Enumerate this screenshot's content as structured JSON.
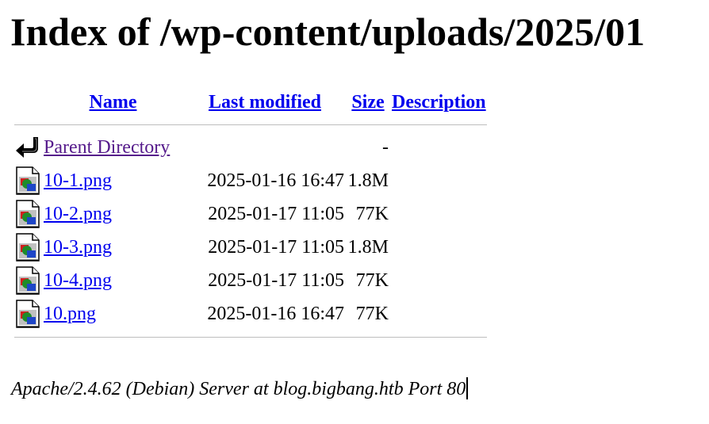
{
  "page": {
    "heading": "Index of /wp-content/uploads/2025/01"
  },
  "table": {
    "headers": {
      "name": "Name",
      "last_modified": "Last modified",
      "size": "Size",
      "description": "Description"
    },
    "parent": {
      "name": "Parent Directory",
      "size": "-",
      "icon": "back-icon"
    },
    "rows": [
      {
        "name": "10-1.png",
        "last_modified": "2025-01-16 16:47",
        "size": "1.8M",
        "icon": "image-icon"
      },
      {
        "name": "10-2.png",
        "last_modified": "2025-01-17 11:05",
        "size": "77K",
        "icon": "image-icon"
      },
      {
        "name": "10-3.png",
        "last_modified": "2025-01-17 11:05",
        "size": "1.8M",
        "icon": "image-icon"
      },
      {
        "name": "10-4.png",
        "last_modified": "2025-01-17 11:05",
        "size": "77K",
        "icon": "image-icon"
      },
      {
        "name": "10.png",
        "last_modified": "2025-01-16 16:47",
        "size": "77K",
        "icon": "image-icon"
      }
    ]
  },
  "footer": {
    "server_signature": "Apache/2.4.62 (Debian) Server at blog.bigbang.htb Port 80"
  },
  "colors": {
    "link": "#0000ee",
    "visited_link": "#551a8b",
    "rule": "#bdbdbd"
  }
}
